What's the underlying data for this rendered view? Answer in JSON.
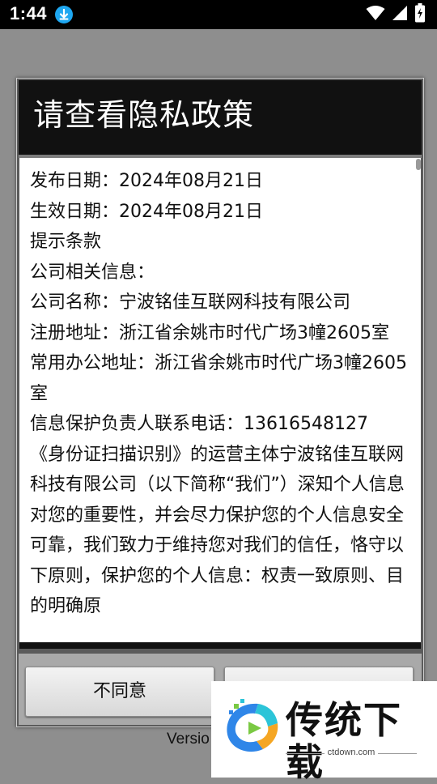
{
  "status_bar": {
    "time": "1:44",
    "icons": [
      "download-icon",
      "wifi-icon",
      "signal-icon",
      "battery-icon"
    ]
  },
  "background": {
    "version_text": "Versio"
  },
  "dialog": {
    "title": "请查看隐私政策",
    "paragraphs": [
      "发布日期：2024年08月21日",
      "生效日期：2024年08月21日",
      "提示条款",
      "公司相关信息：",
      "公司名称：宁波铭佳互联网科技有限公司",
      "注册地址：浙江省余姚市时代广场3幢2605室",
      "常用办公地址：浙江省余姚市时代广场3幢2605室",
      "信息保护负责人联系电话：13616548127",
      "《身份证扫描识别》的运营主体宁波铭佳互联网科技有限公司（以下简称“我们”）深知个人信息对您的重要性，并会尽力保护您的个人信息安全可靠，我们致力于维持您对我们的信任，恪守以下原则，保护您的个人信息：权责一致原则、目的明确原"
    ],
    "buttons": {
      "disagree": "不同意"
    }
  },
  "watermark": {
    "brand": "传统下载",
    "url": "ctdown.com"
  },
  "colors": {
    "status_bar_bg": "#000000",
    "dialog_title_bg": "#111111",
    "download_badge": "#1ea7f1",
    "overlay_bg": "#8e8e8e"
  }
}
